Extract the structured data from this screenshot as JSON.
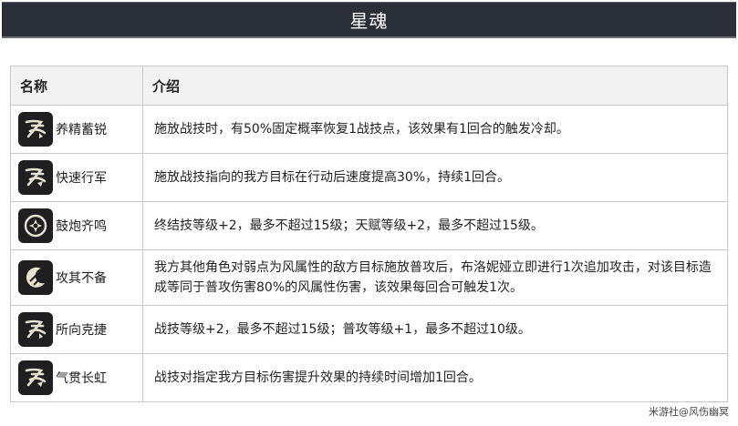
{
  "header": {
    "title": "星魂"
  },
  "table": {
    "columns": [
      "名称",
      "介绍"
    ],
    "rows": [
      {
        "name": "养精蓄锐",
        "icon": "wind-slash-icon",
        "desc": "施放战技时，有50%固定概率恢复1战技点，该效果有1回合的触发冷却。"
      },
      {
        "name": "快速行军",
        "icon": "wind-slash-icon",
        "desc": "施放战技指向的我方目标在行动后速度提高30%，持续1回合。"
      },
      {
        "name": "鼓炮齐鸣",
        "icon": "spiral-emblem-icon",
        "desc": "终结技等级+2，最多不超过15级；天赋等级+2，最多不超过15级。"
      },
      {
        "name": "攻其不备",
        "icon": "crescent-slash-icon",
        "desc": "我方其他角色对弱点为风属性的敌方目标施放普攻后，布洛妮娅立即进行1次追加攻击，对该目标造成等同于普攻伤害80%的风属性伤害，该效果每回合可触发1次。"
      },
      {
        "name": "所向克捷",
        "icon": "wind-slash-icon",
        "desc": "战技等级+2，最多不超过15级；普攻等级+1，最多不超过10级。"
      },
      {
        "name": "气贯长虹",
        "icon": "wind-slash-icon",
        "desc": "战技对指定我方目标伤害提升效果的持续时间增加1回合。"
      }
    ]
  },
  "watermark": "米游社@风伤幽冥"
}
